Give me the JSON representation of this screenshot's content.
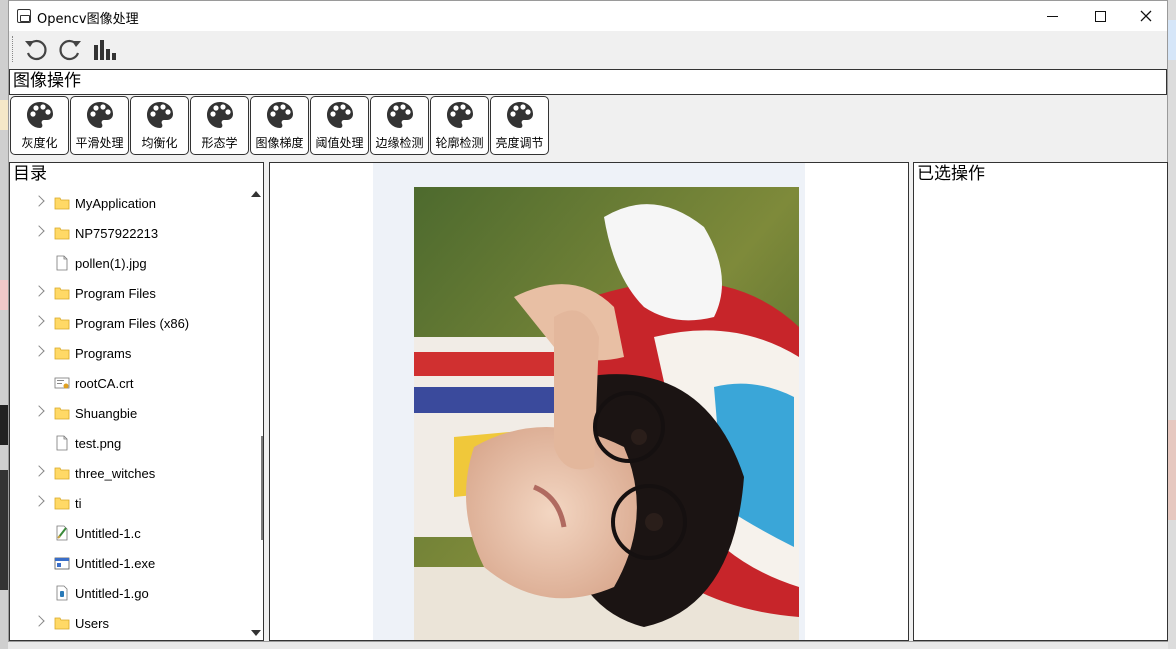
{
  "window": {
    "title": "Opencv图像处理",
    "minimize_icon": "minimize-icon",
    "maximize_icon": "maximize-icon",
    "close_icon": "close-icon"
  },
  "toolbar": {
    "items": [
      {
        "name": "undo",
        "icon": "undo-icon"
      },
      {
        "name": "redo",
        "icon": "redo-icon"
      },
      {
        "name": "histogram",
        "icon": "bar-chart-icon"
      }
    ]
  },
  "operations": {
    "header": "图像操作",
    "buttons": [
      {
        "label": "灰度化",
        "icon": "palette-icon"
      },
      {
        "label": "平滑处理",
        "icon": "palette-icon"
      },
      {
        "label": "均衡化",
        "icon": "palette-icon"
      },
      {
        "label": "形态学",
        "icon": "palette-icon"
      },
      {
        "label": "图像梯度",
        "icon": "palette-icon"
      },
      {
        "label": "阈值处理",
        "icon": "palette-icon"
      },
      {
        "label": "边缘检测",
        "icon": "palette-icon"
      },
      {
        "label": "轮廓检测",
        "icon": "palette-icon"
      },
      {
        "label": "亮度调节",
        "icon": "palette-icon"
      }
    ]
  },
  "directory": {
    "header": "目录",
    "items": [
      {
        "name": "MyApplication",
        "type": "folder",
        "expandable": true
      },
      {
        "name": "NP757922213",
        "type": "folder",
        "expandable": true
      },
      {
        "name": "pollen(1).jpg",
        "type": "file",
        "expandable": false
      },
      {
        "name": "Program Files",
        "type": "folder",
        "expandable": true
      },
      {
        "name": "Program Files (x86)",
        "type": "folder",
        "expandable": true
      },
      {
        "name": "Programs",
        "type": "folder",
        "expandable": true
      },
      {
        "name": "rootCA.crt",
        "type": "certificate",
        "expandable": false
      },
      {
        "name": "Shuangbie",
        "type": "folder",
        "expandable": true
      },
      {
        "name": "test.png",
        "type": "file",
        "expandable": false
      },
      {
        "name": "three_witches",
        "type": "folder",
        "expandable": true
      },
      {
        "name": "ti",
        "type": "folder",
        "expandable": true
      },
      {
        "name": "Untitled-1.c",
        "type": "source",
        "expandable": false
      },
      {
        "name": "Untitled-1.exe",
        "type": "executable",
        "expandable": false
      },
      {
        "name": "Untitled-1.go",
        "type": "gofile",
        "expandable": false
      },
      {
        "name": "Users",
        "type": "folder",
        "expandable": true
      }
    ]
  },
  "selected": {
    "header": "已选操作"
  },
  "colors": {
    "folder": "#ffd966",
    "border": "#333333",
    "panel_bg": "#ffffff"
  }
}
